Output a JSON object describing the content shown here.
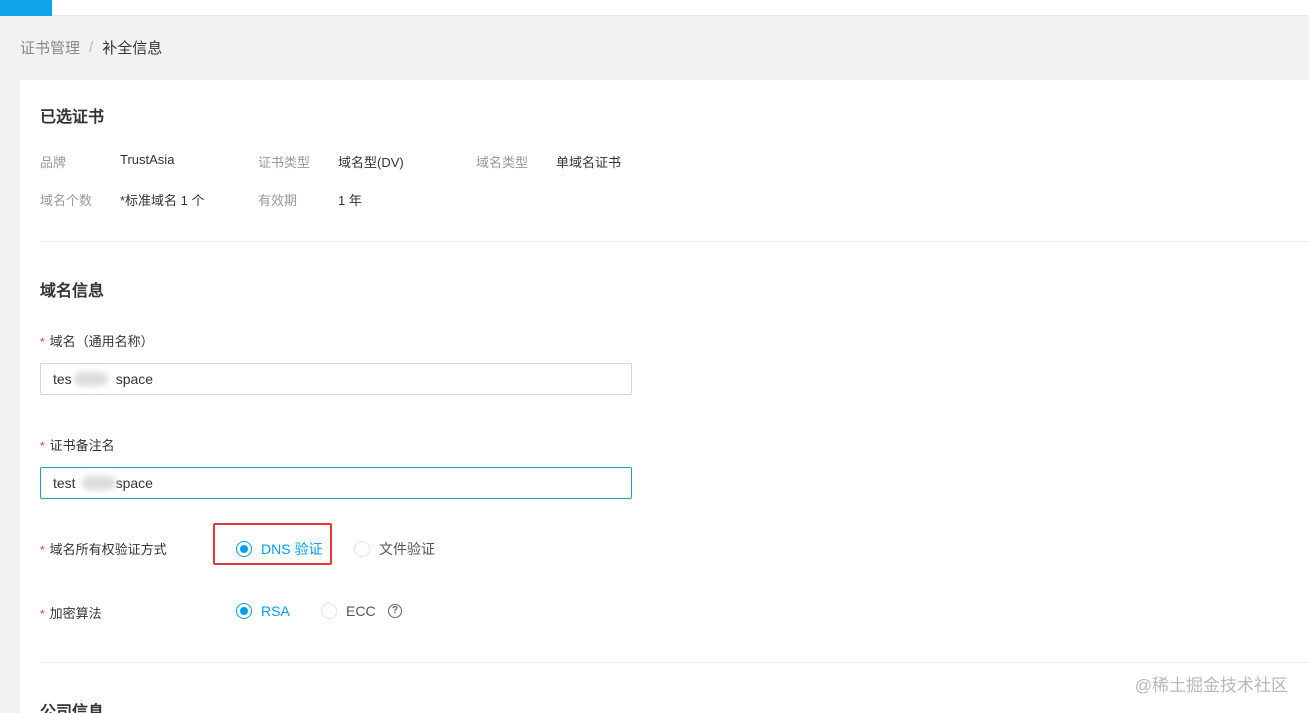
{
  "breadcrumb": {
    "parent": "证书管理",
    "separator": "/",
    "current": "补全信息"
  },
  "selected_cert": {
    "title": "已选证书",
    "brand_label": "品牌",
    "brand_value": "TrustAsia",
    "type_label": "证书类型",
    "type_value": "域名型(DV)",
    "domain_type_label": "域名类型",
    "domain_type_value": "单域名证书",
    "count_label": "域名个数",
    "count_value": "*标准域名 1 个",
    "validity_label": "有效期",
    "validity_value": "1 年"
  },
  "domain_info": {
    "title": "域名信息",
    "required_mark": "*",
    "domain_label": "域名（通用名称）",
    "domain_value_prefix": "tes",
    "domain_value_suffix": "space",
    "remark_label": "证书备注名",
    "remark_value_prefix": "test",
    "remark_value_suffix": "space",
    "verify_label": "域名所有权验证方式",
    "verify_options": [
      "DNS 验证",
      "文件验证"
    ],
    "verify_selected": "DNS 验证",
    "algo_label": "加密算法",
    "algo_options": [
      "RSA",
      "ECC"
    ],
    "algo_selected": "RSA",
    "help_glyph": "?"
  },
  "company_info": {
    "title": "公司信息"
  },
  "watermark": "@稀土掘金技术社区",
  "colors": {
    "accent": "#00a0e9",
    "required": "#e4393c",
    "highlight": "#e53935",
    "focus_border": "#1aa2b8"
  },
  "icons": {
    "help": "question-circle-icon"
  }
}
